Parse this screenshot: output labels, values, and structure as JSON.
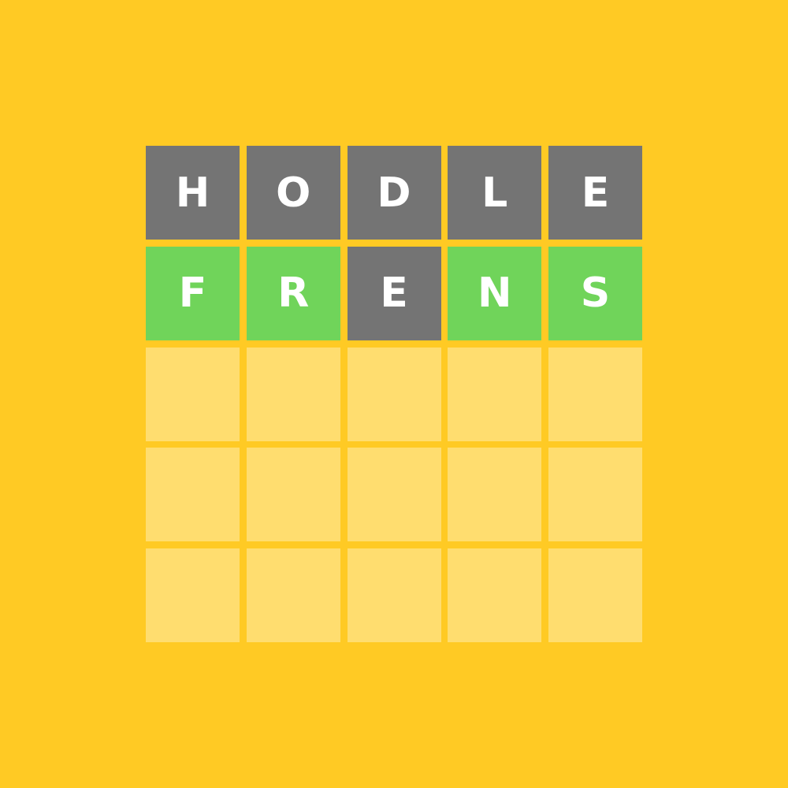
{
  "colors": {
    "background": "#FFCA24",
    "absent": "#747474",
    "correct": "#70D45A",
    "empty": "#FFDD6F",
    "letter": "#FFFFFF"
  },
  "board": {
    "rows": [
      {
        "tiles": [
          {
            "letter": "H",
            "state": "absent"
          },
          {
            "letter": "O",
            "state": "absent"
          },
          {
            "letter": "D",
            "state": "absent"
          },
          {
            "letter": "L",
            "state": "absent"
          },
          {
            "letter": "E",
            "state": "absent"
          }
        ]
      },
      {
        "tiles": [
          {
            "letter": "F",
            "state": "correct"
          },
          {
            "letter": "R",
            "state": "correct"
          },
          {
            "letter": "E",
            "state": "absent"
          },
          {
            "letter": "N",
            "state": "correct"
          },
          {
            "letter": "S",
            "state": "correct"
          }
        ]
      },
      {
        "tiles": [
          {
            "letter": "",
            "state": "empty"
          },
          {
            "letter": "",
            "state": "empty"
          },
          {
            "letter": "",
            "state": "empty"
          },
          {
            "letter": "",
            "state": "empty"
          },
          {
            "letter": "",
            "state": "empty"
          }
        ]
      },
      {
        "tiles": [
          {
            "letter": "",
            "state": "empty"
          },
          {
            "letter": "",
            "state": "empty"
          },
          {
            "letter": "",
            "state": "empty"
          },
          {
            "letter": "",
            "state": "empty"
          },
          {
            "letter": "",
            "state": "empty"
          }
        ]
      },
      {
        "tiles": [
          {
            "letter": "",
            "state": "empty"
          },
          {
            "letter": "",
            "state": "empty"
          },
          {
            "letter": "",
            "state": "empty"
          },
          {
            "letter": "",
            "state": "empty"
          },
          {
            "letter": "",
            "state": "empty"
          }
        ]
      }
    ]
  }
}
